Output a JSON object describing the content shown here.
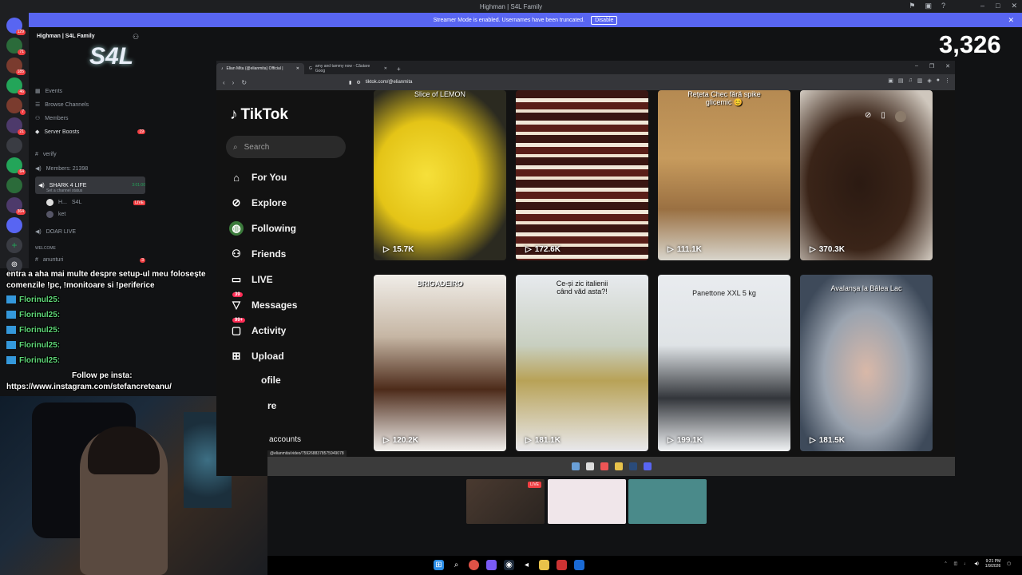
{
  "window": {
    "title": "Highman | S4L Family"
  },
  "streamer_banner": {
    "text": "Streamer Mode is enabled. Usernames have been truncated.",
    "disable_label": "Disable"
  },
  "discord": {
    "server_name": "Highman | S4L Family",
    "rail_badges": [
      "129",
      "71",
      "185",
      "46",
      "7",
      "21",
      "64",
      "364"
    ],
    "menu": [
      "Events",
      "Browse Channels",
      "Members",
      "Server Boosts"
    ],
    "server_boosts_count": "19",
    "channels": {
      "verify": "verify",
      "members": "Members: 21398",
      "voice_channel": "SHARK 4 LIFE",
      "voice_time": "3:01:00",
      "voice_status": "Set a channel status",
      "user1": "H...",
      "user1_tag": "S4L",
      "user1_live": "LIVE",
      "user2": "ket",
      "doar_live": "DOAR LIVE",
      "welcome": "WELCOME",
      "anunturi": "anunturi",
      "anunturi_count": "3"
    }
  },
  "chat": {
    "lines": [
      {
        "name": "",
        "text": "entra a aha mai multe despre setup-ul meu folosește"
      },
      {
        "name": "",
        "text": "comenzile !pc, !monitoare si !periferice"
      },
      {
        "name": "Florinul25:",
        "text": ""
      },
      {
        "name": "Florinul25:",
        "text": ""
      },
      {
        "name": "Florinul25:",
        "text": ""
      },
      {
        "name": "Florinul25:",
        "text": ""
      },
      {
        "name": "Florinul25:",
        "text": ""
      },
      {
        "name": "",
        "text": "Follow pe insta:"
      },
      {
        "name": "",
        "text": "https://www.instagram.com/stefancreteanu/"
      }
    ],
    "emote_multiplier": "x5"
  },
  "counter": "3,326",
  "browser": {
    "tabs": [
      {
        "label": "Elian Mita (@elianmita) Official |",
        "active": true
      },
      {
        "label": "amy and tammy now - Căutare Goog",
        "active": false
      }
    ],
    "url": "tiktok.com/@elianmita",
    "link_status": "@elianmita/video/7592688378575949078"
  },
  "tiktok": {
    "logo": "TikTok",
    "search_placeholder": "Search",
    "nav": [
      {
        "label": "For You",
        "icon": "home-icon",
        "badge": ""
      },
      {
        "label": "Explore",
        "icon": "compass-icon",
        "badge": ""
      },
      {
        "label": "Following",
        "icon": "following-icon",
        "badge": ""
      },
      {
        "label": "Friends",
        "icon": "friends-icon",
        "badge": ""
      },
      {
        "label": "LIVE",
        "icon": "live-icon",
        "badge": ""
      },
      {
        "label": "Messages",
        "icon": "messages-icon",
        "badge": "39"
      },
      {
        "label": "Activity",
        "icon": "activity-icon",
        "badge": "99+"
      },
      {
        "label": "Upload",
        "icon": "upload-icon",
        "badge": ""
      },
      {
        "label": "ofile",
        "icon": "profile-icon",
        "badge": ""
      },
      {
        "label": "re",
        "icon": "more-icon",
        "badge": ""
      }
    ],
    "footer": "accounts",
    "videos": [
      {
        "views": "15.7K",
        "caption": "Slice of LEMON"
      },
      {
        "views": "172.6K",
        "caption": ""
      },
      {
        "views": "111.1K",
        "caption": "Rețeta Chec fără spike glicemic 😊"
      },
      {
        "views": "370.3K",
        "caption": ""
      },
      {
        "views": "120.2K",
        "caption": "BRIGADEIRO"
      },
      {
        "views": "181.1K",
        "caption": "Ce-și zic italienii când văd asta?!"
      },
      {
        "views": "199.1K",
        "caption": "Panettone XXL 5 kg"
      },
      {
        "views": "181.5K",
        "caption": "Avalanșa la Bâlea Lac"
      }
    ]
  },
  "previews": {
    "live_label": "LIVE"
  },
  "taskbar": {
    "time": "9:21 PM",
    "date": "1/9/2026"
  }
}
